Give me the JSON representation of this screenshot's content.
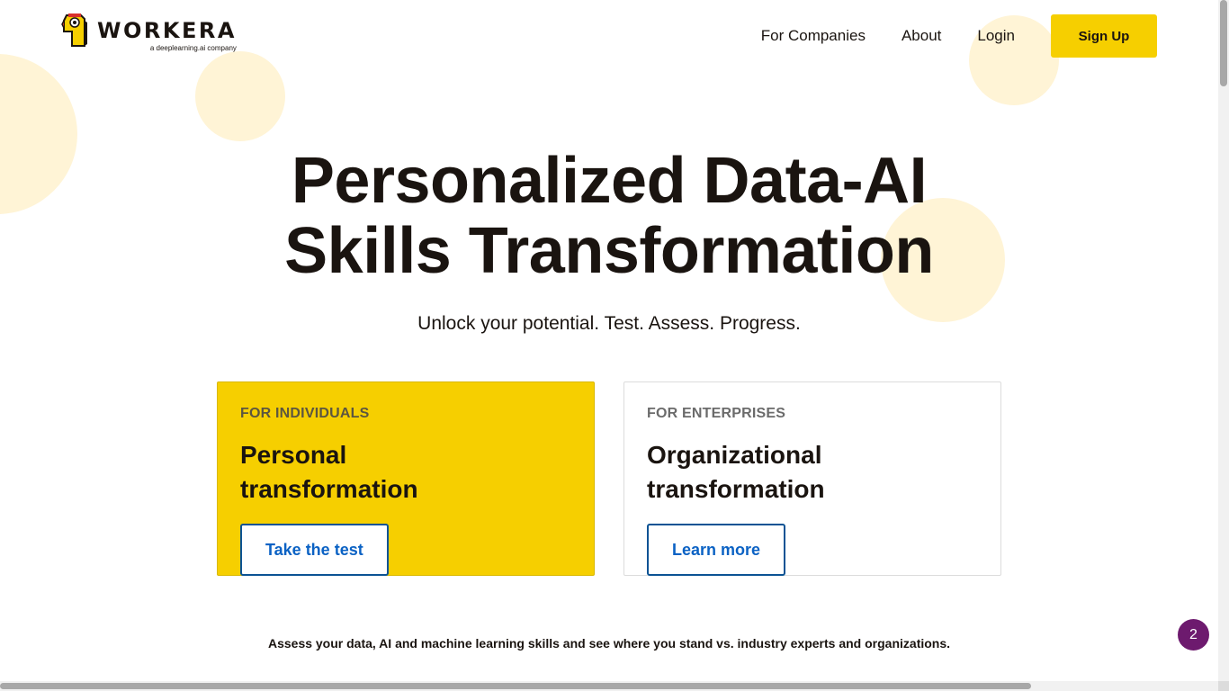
{
  "logo": {
    "word": "WORKERA",
    "sub": "a deeplearning.ai company",
    "icon": "workera-bird-icon"
  },
  "nav": {
    "items": [
      "For Companies",
      "About",
      "Login"
    ],
    "signup_label": "Sign Up"
  },
  "hero": {
    "title_line1": "Personalized Data-AI",
    "title_line2": "Skills Transformation",
    "subtitle": "Unlock your potential. Test. Assess. Progress."
  },
  "cards": [
    {
      "kicker": "FOR INDIVIDUALS",
      "title": "Personal transformation",
      "button": "Take the test"
    },
    {
      "kicker": "FOR ENTERPRISES",
      "title": "Organizational transformation",
      "button": "Learn more"
    }
  ],
  "bottom_text": "Assess your data, AI and machine learning skills and see where you stand vs. industry experts and organizations.",
  "badge": {
    "count": "2"
  },
  "colors": {
    "brand_yellow": "#f6cf00",
    "decor_circle": "#fff4d6",
    "link_blue": "#0b62c4",
    "badge_purple": "#6d1a6e"
  }
}
